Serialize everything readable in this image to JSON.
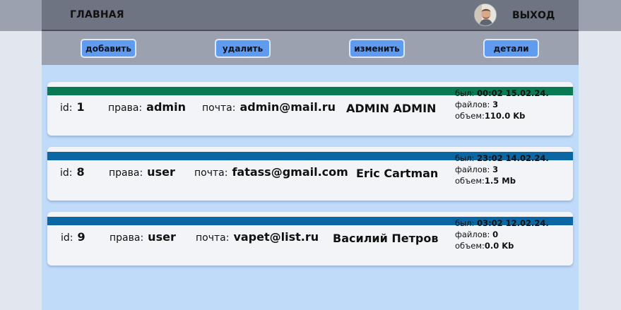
{
  "header": {
    "home_label": "ГЛАВНАЯ",
    "logout_label": "ВЫХОД"
  },
  "toolbar": {
    "add_label": "добавить",
    "delete_label": "удалить",
    "edit_label": "изменить",
    "details_label": "детали"
  },
  "labels": {
    "id": "id:",
    "role": "права:",
    "email": "почта:",
    "seen": "был:",
    "files": "файлов:",
    "volume": "объем:"
  },
  "users": [
    {
      "id": "1",
      "role": "admin",
      "email": "admin@mail.ru",
      "name": "ADMIN ADMIN",
      "last_seen": "00:02 15.02.24.",
      "files": "3",
      "volume": "110.0 Kb",
      "bar_color": "#0a7a55"
    },
    {
      "id": "8",
      "role": "user",
      "email": "fatass@gmail.com",
      "name": "Eric Cartman",
      "last_seen": "23:02 14.02.24.",
      "files": "3",
      "volume": "1.5 Mb",
      "bar_color": "#0b67a3"
    },
    {
      "id": "9",
      "role": "user",
      "email": "vapet@list.ru",
      "name": "Василий Петров",
      "last_seen": "03:02 12.02.24.",
      "files": "0",
      "volume": "0.0 Kb",
      "bar_color": "#0b67a3"
    }
  ],
  "colors": {
    "header_bg": "#6e7482",
    "toolbar_bg": "#9ba1ae",
    "content_bg": "#c0dafa",
    "button_bg": "#5f9cf0",
    "admin_bar": "#0a7a55",
    "user_bar": "#0b67a3"
  },
  "icons": {
    "avatar": "user-avatar-photo"
  }
}
